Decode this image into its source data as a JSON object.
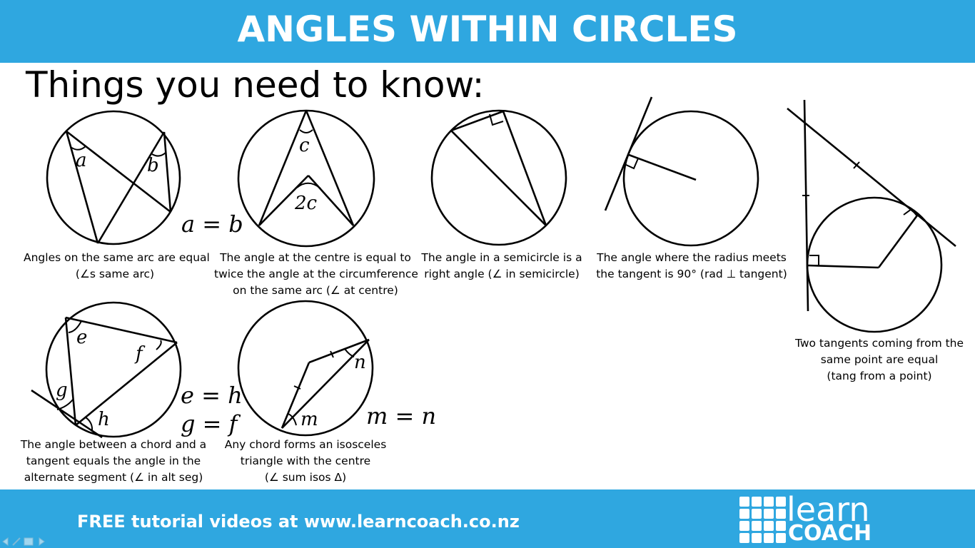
{
  "header": {
    "title": "ANGLES WITHIN CIRCLES"
  },
  "subtitle": "Things you need to know:",
  "diagram_labels": {
    "a": "a",
    "b": "b",
    "c": "c",
    "two_c": "2c",
    "e": "e",
    "f": "f",
    "g": "g",
    "h": "h",
    "m": "m",
    "n": "n"
  },
  "equations": {
    "a_eq_b": "a = b",
    "e_eq_h": "e = h",
    "g_eq_f": "g = f",
    "m_eq_n": "m = n"
  },
  "captions": {
    "same_arc": [
      "Angles on the same arc are equal",
      "(∠s same arc)"
    ],
    "centre": [
      "The angle at the centre is equal to",
      "twice the angle at the circumference",
      "on the same arc (∠ at centre)"
    ],
    "semicircle": [
      "The angle in a semicircle is a",
      "right angle (∠ in semicircle)"
    ],
    "tangent_radius": [
      "The angle where the radius meets",
      "the tangent is 90° (rad ⊥ tangent)"
    ],
    "two_tangents": [
      "Two tangents coming from the",
      "same point are equal",
      "(tang from a point)"
    ],
    "alt_segment": [
      "The angle between a chord and a",
      "tangent equals the angle in the",
      "alternate segment (∠ in alt seg)"
    ],
    "isosceles": [
      "Any chord forms an isosceles",
      "triangle with the centre",
      "(∠ sum isos Δ)"
    ]
  },
  "footer": {
    "text": "FREE tutorial videos at www.learncoach.co.nz",
    "logo_top": "learn",
    "logo_bottom": "COACH"
  },
  "colors": {
    "banner": "#2fa7e0",
    "text": "#000000",
    "white": "#ffffff"
  }
}
